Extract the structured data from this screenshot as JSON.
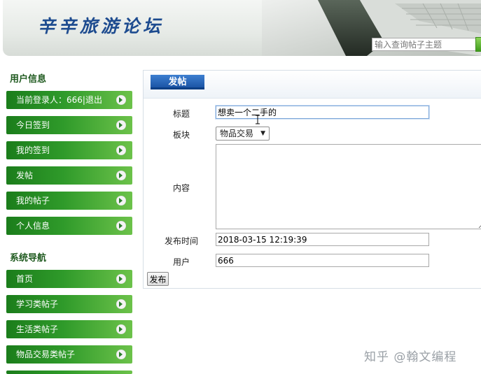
{
  "header": {
    "site_title": "辛辛旅游论坛",
    "search": {
      "placeholder": "输入查询帖子主题",
      "value": ""
    }
  },
  "sidebar": {
    "user_section_title": "用户信息",
    "user_items": [
      {
        "label": "当前登录人：666|",
        "link": "退出"
      },
      {
        "label": "今日签到"
      },
      {
        "label": "我的签到"
      },
      {
        "label": "发帖"
      },
      {
        "label": "我的帖子"
      },
      {
        "label": "个人信息"
      }
    ],
    "nav_section_title": "系统导航",
    "nav_items": [
      {
        "label": "首页"
      },
      {
        "label": "学习类帖子"
      },
      {
        "label": "生活类帖子"
      },
      {
        "label": "物品交易类帖子"
      }
    ]
  },
  "form": {
    "tab_label": "发帖",
    "title_label": "标题",
    "title_value": "想卖一个二手的",
    "board_label": "板块",
    "board_value": "物品交易",
    "content_label": "内容",
    "content_value": "",
    "time_label": "发布时间",
    "time_value": "2018-03-15 12:19:39",
    "user_label": "用户",
    "user_value": "666",
    "submit_label": "发布"
  },
  "watermark": "知乎 @翰文编程",
  "colors": {
    "nav_green_dark": "#1b7d1b",
    "nav_green_light": "#6cc24a",
    "tab_blue": "#1c55a6",
    "title_blue": "#1d4b8f"
  }
}
